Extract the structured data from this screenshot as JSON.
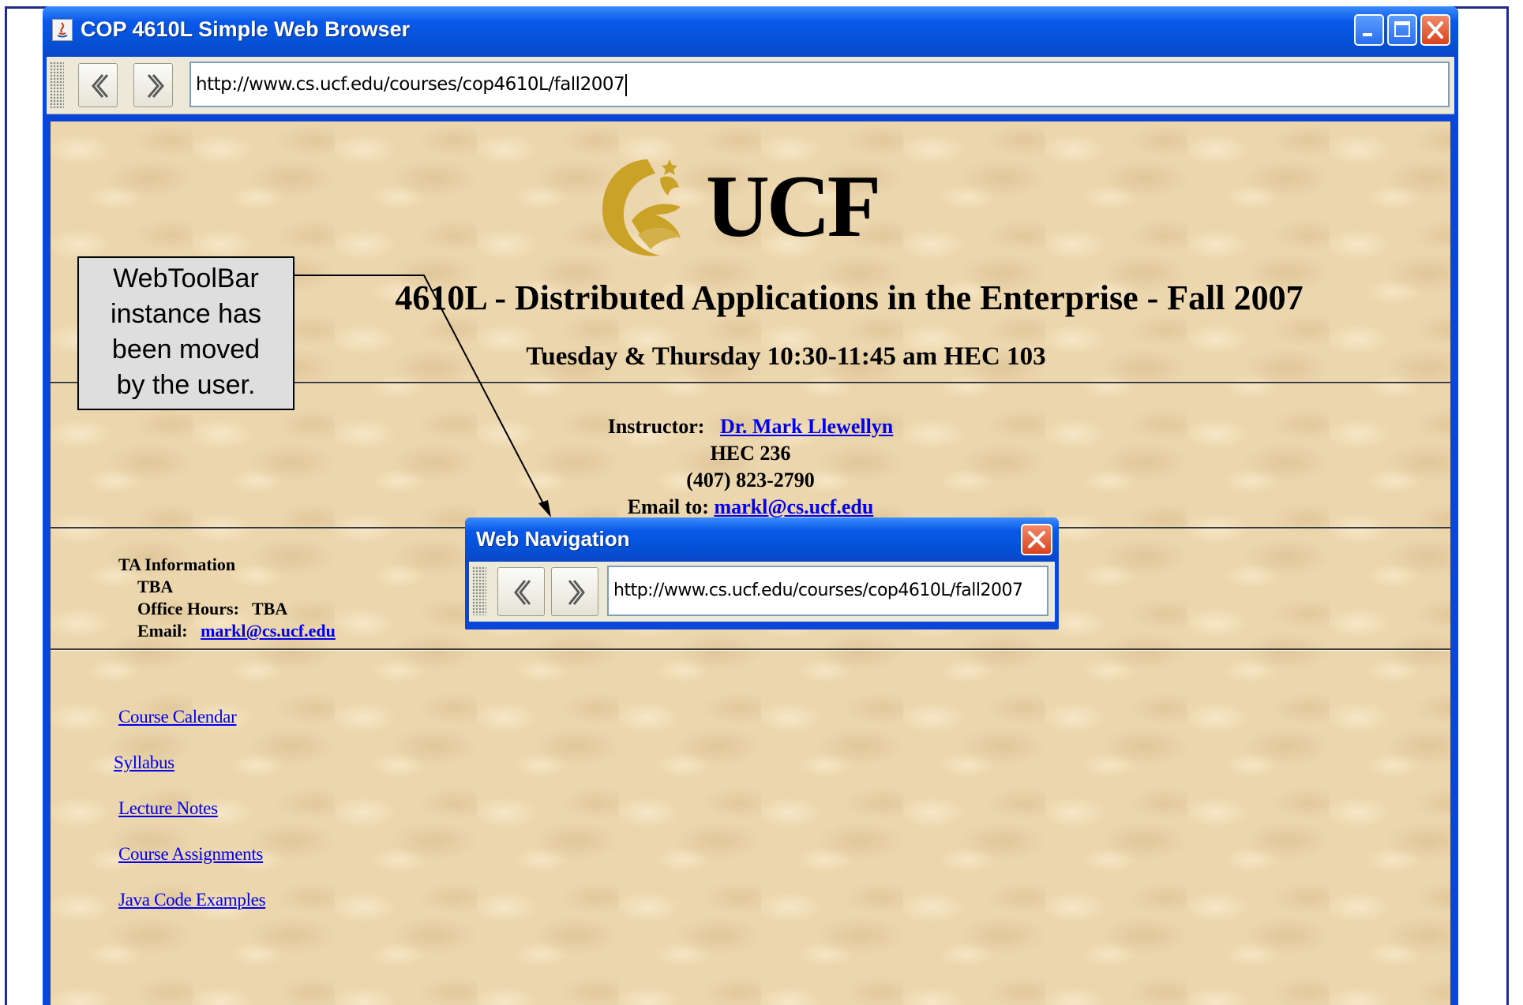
{
  "window": {
    "title": "COP 4610L Simple Web Browser",
    "url": "http://www.cs.ucf.edu/courses/cop4610L/fall2007"
  },
  "page": {
    "logo_text": "UCF",
    "course_title": "4610L - Distributed Applications in the Enterprise - Fall 2007",
    "schedule": "Tuesday & Thursday 10:30-11:45 am HEC 103",
    "instructor_label": "Instructor:",
    "instructor_name": "Dr. Mark Llewellyn",
    "office": "HEC 236",
    "phone": "(407) 823-2790",
    "email_label": "Email to:",
    "email": "markl@cs.ucf.edu",
    "ta": {
      "heading": "TA Information",
      "name": "TBA",
      "office_hours": "Office Hours:   TBA",
      "email_label": "Email:",
      "email": "markl@cs.ucf.edu"
    },
    "links": [
      "Course Calendar",
      "Syllabus",
      "Lecture Notes",
      "Course Assignments",
      "Java Code Examples"
    ]
  },
  "annotation": {
    "text_line1": "WebToolBar",
    "text_line2": "instance has",
    "text_line3": "been moved",
    "text_line4": "by the user."
  },
  "floating_toolbar": {
    "title": "Web Navigation",
    "url": "http://www.cs.ucf.edu/courses/cop4610L/fall2007"
  },
  "colors": {
    "xp_blue": "#0a46d8",
    "toolbar_bg": "#ece9d8",
    "page_bg": "#ecd6ad",
    "link": "#0000ee",
    "logo_gold": "#c9a227"
  },
  "icons": [
    "java-icon",
    "minimize-icon",
    "maximize-icon",
    "close-icon",
    "back-arrow-icon",
    "forward-arrow-icon"
  ]
}
